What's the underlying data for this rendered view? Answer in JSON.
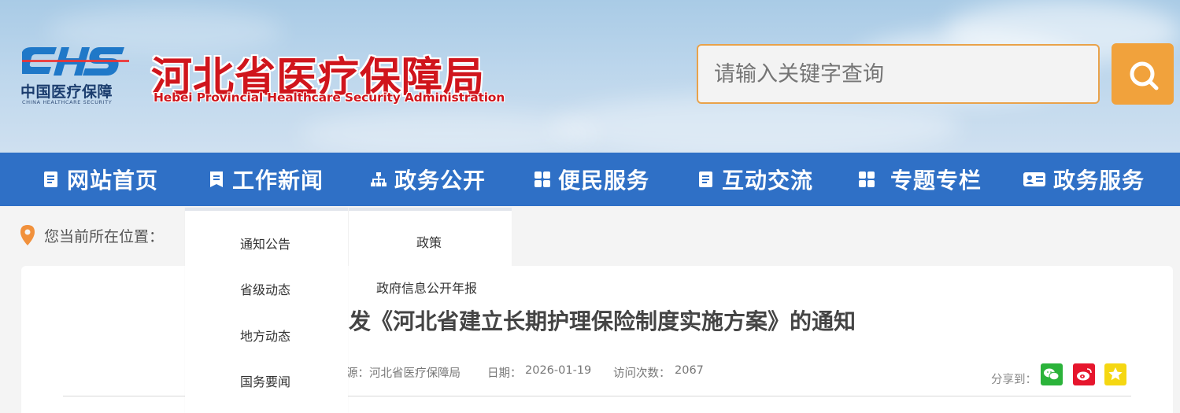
{
  "header": {
    "logo_cn": "中国医疗保障",
    "logo_en": "CHINA HEALTHCARE SECURITY",
    "title_cn": "河北省医疗保障局",
    "title_en": "Hebei Provincial Healthcare Security Administration"
  },
  "search": {
    "placeholder": "请输入关键字查询",
    "button_icon": "search-icon"
  },
  "nav": {
    "items": [
      {
        "label": "网站首页",
        "icon": "document-icon"
      },
      {
        "label": "工作新闻",
        "icon": "bookmark-icon"
      },
      {
        "label": "政务公开",
        "icon": "org-chart-icon"
      },
      {
        "label": "便民服务",
        "icon": "grid-icon"
      },
      {
        "label": "互动交流",
        "icon": "document-icon"
      },
      {
        "label": "专题专栏",
        "icon": "grid-icon"
      },
      {
        "label": "政务服务",
        "icon": "id-card-icon"
      }
    ]
  },
  "breadcrumb": {
    "label": "您当前所在位置：",
    "icon": "location-pin-icon"
  },
  "dropdown": {
    "news_items": [
      "通知公告",
      "省级动态",
      "地方动态",
      "国务要闻"
    ],
    "open_items": [
      "政策",
      "政府信息公开年报"
    ]
  },
  "article": {
    "title_visible": "发《河北省建立长期护理保险制度实施方案》的通知",
    "source_label": "源：",
    "source_value": "河北省医疗保障局",
    "date_label": "日期：",
    "date_value": "2026-01-19",
    "visits_label": "访问次数：",
    "visits_value": "2067",
    "share_label": "分享到："
  },
  "share_buttons": [
    {
      "name": "wechat",
      "icon": "wechat-icon",
      "color": "#2bb33a"
    },
    {
      "name": "weibo",
      "icon": "weibo-icon",
      "color": "#e6162d"
    },
    {
      "name": "qzone",
      "icon": "star-icon",
      "color": "#f5d712"
    }
  ],
  "colors": {
    "nav_bg": "#2f70c6",
    "accent_orange": "#f1a23c",
    "title_red": "#d0151c"
  }
}
